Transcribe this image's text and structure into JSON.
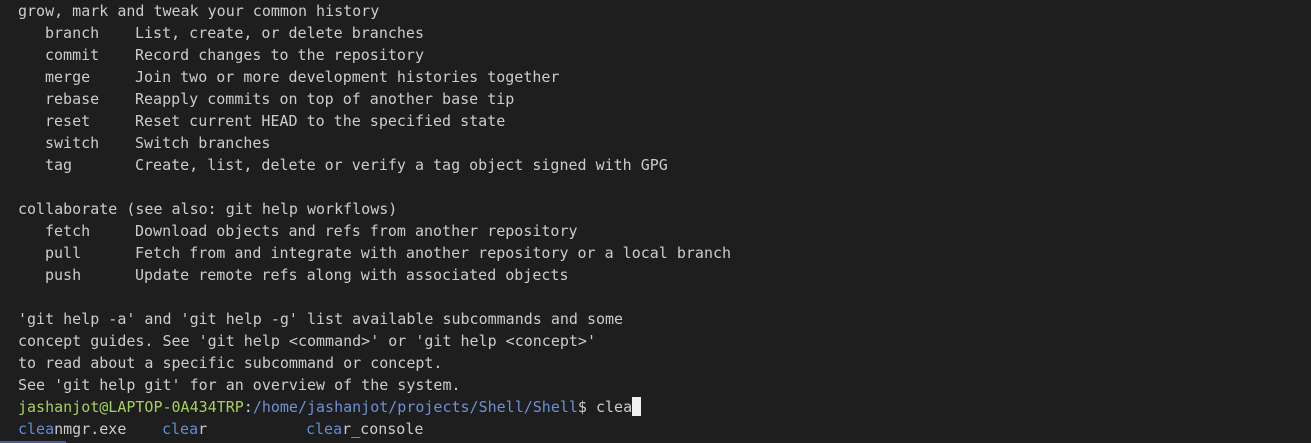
{
  "heading_grow": "grow, mark and tweak your common history",
  "grow_cmds": [
    {
      "name": "branch",
      "desc": "List, create, or delete branches"
    },
    {
      "name": "commit",
      "desc": "Record changes to the repository"
    },
    {
      "name": "merge",
      "desc": "Join two or more development histories together"
    },
    {
      "name": "rebase",
      "desc": "Reapply commits on top of another base tip"
    },
    {
      "name": "reset",
      "desc": "Reset current HEAD to the specified state"
    },
    {
      "name": "switch",
      "desc": "Switch branches"
    },
    {
      "name": "tag",
      "desc": "Create, list, delete or verify a tag object signed with GPG"
    }
  ],
  "heading_collab": "collaborate (see also: git help workflows)",
  "collab_cmds": [
    {
      "name": "fetch",
      "desc": "Download objects and refs from another repository"
    },
    {
      "name": "pull",
      "desc": "Fetch from and integrate with another repository or a local branch"
    },
    {
      "name": "push",
      "desc": "Update remote refs along with associated objects"
    }
  ],
  "help_lines": [
    "'git help -a' and 'git help -g' list available subcommands and some",
    "concept guides. See 'git help <command>' or 'git help <concept>'",
    "to read about a specific subcommand or concept.",
    "See 'git help git' for an overview of the system."
  ],
  "prompt": {
    "user_host": "jashanjot@LAPTOP-0A434TRP",
    "sep": ":",
    "path": "/home/jashanjot/projects/Shell/Shell",
    "symbol": "$ ",
    "input": "clea"
  },
  "suggestions": [
    {
      "match": "clea",
      "rest": "nmgr.exe"
    },
    {
      "match": "clea",
      "rest": "r"
    },
    {
      "match": "clea",
      "rest": "r_console"
    }
  ],
  "colors": {
    "background": "#1e1e1e",
    "text": "#cccccc",
    "user_host": "#a6d05d",
    "path": "#6f8fd6",
    "suggestion_match": "#5e8fd6"
  }
}
